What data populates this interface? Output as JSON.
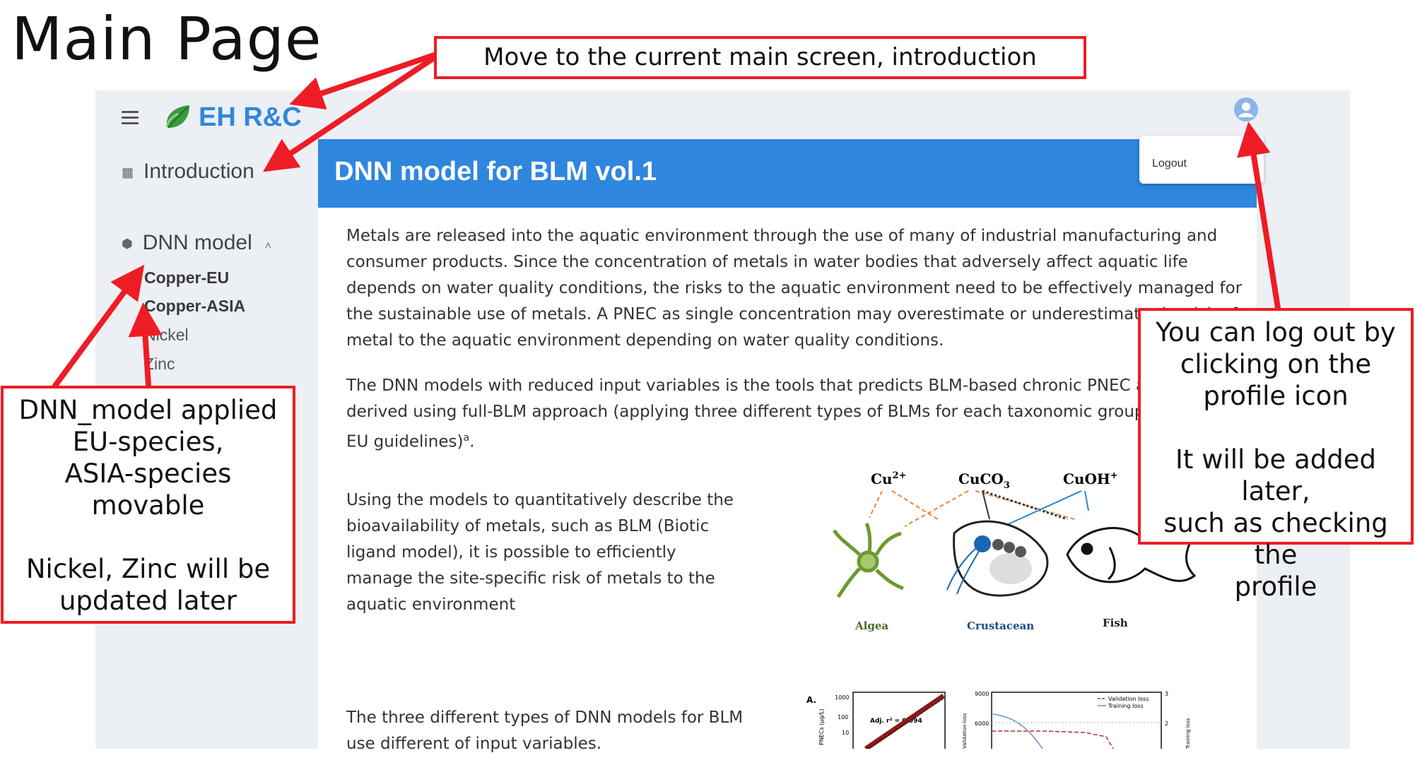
{
  "annotation": {
    "page_title": "Main Page",
    "callout_top": "Move to the current main screen, introduction",
    "callout_left": [
      "DNN_model applied",
      "EU-species,",
      "ASIA-species",
      "movable",
      "",
      "Nickel, Zinc will be",
      "updated later"
    ],
    "callout_right": [
      "You can log out by",
      "clicking on the",
      "profile icon",
      "",
      "It will be added later,",
      "such as checking the",
      "profile"
    ]
  },
  "app": {
    "logo_text": "EH R&C",
    "sidebar": {
      "introduction": "Introduction",
      "dnn_model": "DNN model",
      "sub_items": [
        "Copper-EU",
        "Copper-ASIA",
        "Nickel",
        "Zinc"
      ]
    },
    "header_title": "DNN model for BLM vol.1",
    "profile_menu": {
      "logout": "Logout"
    },
    "paragraphs": {
      "p1": "Metals are released into the aquatic environment through the use of many of industrial manufacturing and consumer products. Since the concentration of metals in water bodies that adversely affect aquatic life depends on water quality conditions, the risks to the aquatic environment need to be effectively managed for the sustainable use of metals. A PNEC as single concentration may overestimate or underestimate the risk of a metal to the aquatic environment depending on water quality conditions.",
      "p2": "The DNN models with reduced input variables is the tools that predicts BLM-based chronic PNEC and acute derived using full-BLM approach (applying three different types of BLMs for each taxonomic group in according EU guidelines)",
      "p2_sup": "a",
      "p3": "Using the models to quantitatively describe the bioavailability of metals, such as BLM (Biotic ligand model), it is possible to efficiently manage the site-specific risk of metals to the aquatic environment",
      "p4": "The three different types of DNN models for BLM use different of input variables."
    },
    "figure_species": {
      "species_labels": [
        "Cu2+",
        "CuCO3",
        "CuOH+"
      ],
      "organism_labels": [
        "Algea",
        "Crustacean",
        "Fish"
      ]
    },
    "figure_plots": {
      "panel_label": "A.",
      "y_ticks_left": [
        "1000",
        "100",
        "10"
      ],
      "y_label_left": "PNECs (μg/L)",
      "r2_label": "Adj. r² = 0.994",
      "y_ticks_mid": [
        "9000",
        "6000"
      ],
      "y_label_mid": "Validation loss",
      "y_ticks_right": [
        "3",
        "2"
      ],
      "y_label_right": "Training loss",
      "legend": [
        "Validation loss",
        "Training loss"
      ]
    }
  }
}
